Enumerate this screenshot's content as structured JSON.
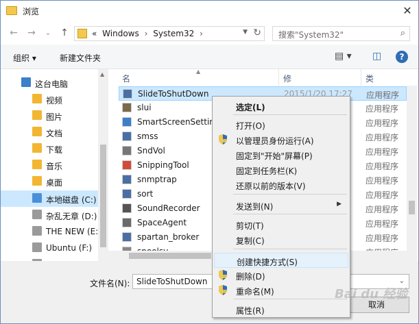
{
  "window": {
    "title": "浏览",
    "close_label": "✕"
  },
  "nav": {
    "back": "←",
    "forward": "→",
    "recent": "⌄",
    "up": "↑",
    "address": {
      "prefix": "«",
      "parts": [
        "Windows",
        "System32"
      ],
      "separator": "›"
    },
    "search_placeholder": "搜索\"System32\""
  },
  "toolbar": {
    "organize": "组织 ▾",
    "new_folder": "新建文件夹",
    "view_icon": "▤ ▾",
    "pane_icon": "◫",
    "help": "?"
  },
  "sidebar": {
    "items": [
      {
        "label": "这台电脑",
        "color": "#3d7fc8",
        "indent": 0
      },
      {
        "label": "视频",
        "color": "#f2b632",
        "indent": 1
      },
      {
        "label": "图片",
        "color": "#f2b632",
        "indent": 1
      },
      {
        "label": "文档",
        "color": "#f2b632",
        "indent": 1
      },
      {
        "label": "下载",
        "color": "#f2b632",
        "indent": 1
      },
      {
        "label": "音乐",
        "color": "#f2b632",
        "indent": 1
      },
      {
        "label": "桌面",
        "color": "#f2b632",
        "indent": 1
      },
      {
        "label": "本地磁盘 (C:)",
        "color": "#4a90d9",
        "indent": 1
      },
      {
        "label": "杂乱无章 (D:)",
        "color": "#9a9a9a",
        "indent": 1
      },
      {
        "label": "THE NEW (E:)",
        "color": "#9a9a9a",
        "indent": 1
      },
      {
        "label": "Ubuntu (F:)",
        "color": "#9a9a9a",
        "indent": 1
      },
      {
        "label": "书籍 (G:)",
        "color": "#9a9a9a",
        "indent": 1
      }
    ]
  },
  "files": {
    "columns": {
      "name": "名称",
      "date": "修改日期",
      "type": "类型"
    },
    "rows": [
      {
        "name": "SlideToShutDown",
        "date": "2015/1/20 17:27",
        "type": "应用程序",
        "color": "#4a6fa5"
      },
      {
        "name": "slui",
        "date": "",
        "type": "应用程序",
        "color": "#7a6a4a"
      },
      {
        "name": "SmartScreenSettings",
        "date": "",
        "type": "应用程序",
        "color": "#3d7fc8"
      },
      {
        "name": "smss",
        "date": "",
        "type": "应用程序",
        "color": "#4a6fa5"
      },
      {
        "name": "SndVol",
        "date": "",
        "type": "应用程序",
        "color": "#777777"
      },
      {
        "name": "SnippingTool",
        "date": "",
        "type": "应用程序",
        "color": "#d24b3a"
      },
      {
        "name": "snmptrap",
        "date": "",
        "type": "应用程序",
        "color": "#4a6fa5"
      },
      {
        "name": "sort",
        "date": "",
        "type": "应用程序",
        "color": "#4a6fa5"
      },
      {
        "name": "SoundRecorder",
        "date": "",
        "type": "应用程序",
        "color": "#555555"
      },
      {
        "name": "SpaceAgent",
        "date": "",
        "type": "应用程序",
        "color": "#6a6a6a"
      },
      {
        "name": "spartan_broker",
        "date": "",
        "type": "应用程序",
        "color": "#4a6fa5"
      },
      {
        "name": "spoolsv",
        "date": "",
        "type": "应用程序",
        "color": "#888888"
      }
    ]
  },
  "bottom": {
    "filename_label": "文件名(N):",
    "filename_value": "SlideToShutDown",
    "cancel": "取消"
  },
  "context_menu": {
    "items": [
      {
        "label": "选定(L)",
        "bold": true,
        "shield": false
      },
      {
        "label": "打开(O)",
        "shield": false
      },
      {
        "label": "以管理员身份运行(A)",
        "shield": true
      },
      {
        "label": "固定到\"开始\"屏幕(P)",
        "shield": false
      },
      {
        "label": "固定到任务栏(K)",
        "shield": false
      },
      {
        "label": "还原以前的版本(V)",
        "shield": false
      },
      {
        "label": "发送到(N)",
        "shield": false,
        "submenu": "▶"
      },
      {
        "label": "剪切(T)",
        "shield": false
      },
      {
        "label": "复制(C)",
        "shield": false
      },
      {
        "label": "创建快捷方式(S)",
        "shield": false,
        "hover": true
      },
      {
        "label": "删除(D)",
        "shield": true
      },
      {
        "label": "重命名(M)",
        "shield": true
      },
      {
        "label": "属性(R)",
        "shield": false
      }
    ]
  },
  "watermark": "Bai du 经验"
}
